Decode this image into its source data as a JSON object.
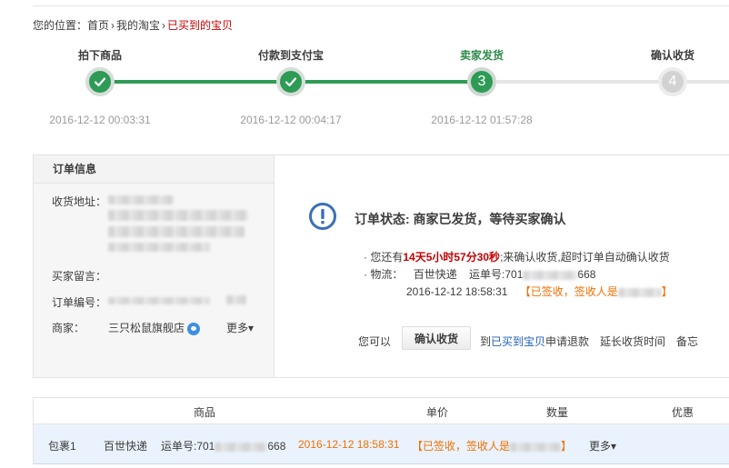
{
  "breadcrumb": {
    "prefix": "您的位置：",
    "items": [
      "首页",
      "我的淘宝"
    ],
    "current": "已买到的宝贝",
    "sep": "›"
  },
  "steps": [
    {
      "label": "拍下商品",
      "time": "2016-12-12 00:03:31",
      "state": "done"
    },
    {
      "label": "付款到支付宝",
      "time": "2016-12-12 00:04:17",
      "state": "done"
    },
    {
      "label": "卖家发货",
      "time": "2016-12-12 01:57:28",
      "state": "current",
      "num": "3"
    },
    {
      "label": "确认收货",
      "time": "",
      "state": "todo",
      "num": "4"
    }
  ],
  "order_info": {
    "title": "订单信息",
    "address_label": "收货地址：",
    "message_label": "买家留言：",
    "order_no_label": "订单编号：",
    "merchant_label": "商家：",
    "merchant_name": "三只松鼠旗舰店",
    "more": "更多▾"
  },
  "status": {
    "title": "订单状态: 商家已发货，等待买家确认",
    "remain_prefix": "· 您还有",
    "remain_time": "14天5小时57分30秒",
    "remain_suffix": ";来确认收货,超时订单自动确认收货",
    "logistics_prefix": "· 物流：",
    "courier": "百世快递",
    "tracking_prefix": "运单号:701",
    "tracking_suffix": "668",
    "sign_time": "2016-12-12 18:58:31",
    "sign_prefix": "【已签收，签收人是",
    "sign_suffix": "】"
  },
  "actions": {
    "can_label": "您可以",
    "confirm_button": "确认收货",
    "to_label": "到",
    "bought_link": "已买到宝贝",
    "refund_text": "申请退款",
    "extend_link": "延长收货时间",
    "note_link": "备忘"
  },
  "table": {
    "headers": [
      "商品",
      "单价",
      "数量",
      "优惠"
    ],
    "package": {
      "name": "包裹1",
      "courier": "百世快递",
      "tracking_prefix": "运单号:701",
      "tracking_suffix": "668",
      "time": "2016-12-12 18:58:31",
      "sign_prefix": "【已签收，签收人是",
      "sign_suffix": "】",
      "more": "更多▾"
    }
  },
  "colors": {
    "accent_green": "#2e9b55",
    "link_blue": "#1e5ebe",
    "alert_red": "#c40000",
    "orange": "#f07000"
  }
}
